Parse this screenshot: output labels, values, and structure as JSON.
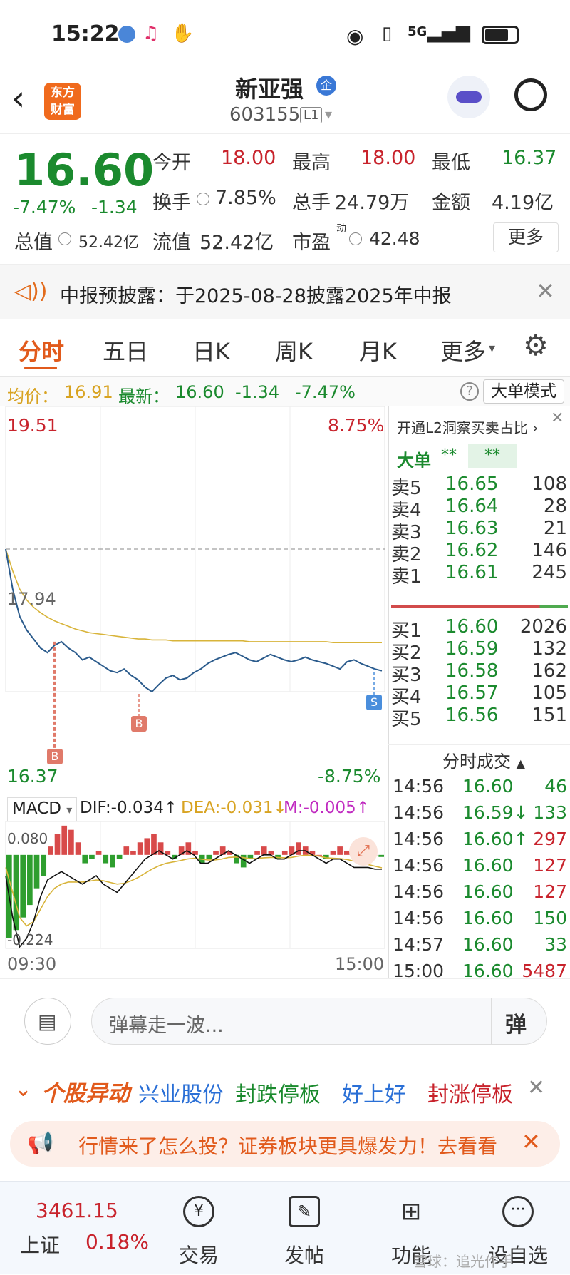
{
  "status_bar": {
    "time": "15:22",
    "network": "5G"
  },
  "header": {
    "app_logo_line1": "东方",
    "app_logo_line2": "财富",
    "stock_name": "新亚强",
    "company_badge": "企",
    "stock_code": "603155",
    "level_badge": "L1"
  },
  "quote": {
    "price": "16.60",
    "change_pct": "-7.47%",
    "change": "-1.34",
    "open_label": "今开",
    "open": "18.00",
    "high_label": "最高",
    "high": "18.00",
    "low_label": "最低",
    "low": "16.37",
    "turnover_label": "换手",
    "turnover": "7.85%",
    "volume_label": "总手",
    "volume": "24.79万",
    "amount_label": "金额",
    "amount": "4.19亿",
    "mktcap_label": "总值",
    "mktcap": "52.42亿",
    "float_label": "流值",
    "float_cap": "52.42亿",
    "pe_label": "市盈",
    "pe_sup": "动",
    "pe": "42.48",
    "more_button": "更多"
  },
  "notice": {
    "text": "中报预披露：于2025-08-28披露2025年中报"
  },
  "tabs": {
    "t1": "分时",
    "t2": "五日",
    "t3": "日K",
    "t4": "周K",
    "t5": "月K",
    "t6": "更多"
  },
  "infobar": {
    "avg_label": "均价：",
    "avg": "16.91",
    "latest_label": "最新：",
    "latest": "16.60",
    "chg": "-1.34",
    "chg_pct": "-7.47%",
    "mode_button": "大单模式"
  },
  "chart": {
    "y_top": "19.51",
    "y_mid": "17.94",
    "y_bottom": "16.37",
    "pct_top": "8.75%",
    "pct_bottom": "-8.75%",
    "marker_b": "B",
    "marker_s": "S",
    "macd_label": "MACD",
    "dif": "DIF:-0.034↑",
    "dea": "DEA:-0.031↓",
    "m": "M:-0.005↑",
    "macd_top": "0.080",
    "macd_bottom": "-0.224",
    "time_start": "09:30",
    "time_end": "15:00",
    "colors": {
      "price_line": "#2b5b8c",
      "avg_line": "#d8b43a",
      "up": "#d84a4a",
      "down": "#2e9e2e"
    }
  },
  "chart_data": {
    "type": "line",
    "ylim": [
      16.37,
      19.51
    ],
    "prev_close": 17.94,
    "price_series": [
      17.94,
      17.5,
      17.2,
      17.05,
      16.95,
      16.85,
      16.8,
      16.88,
      16.92,
      16.85,
      16.8,
      16.72,
      16.75,
      16.7,
      16.65,
      16.6,
      16.58,
      16.62,
      16.55,
      16.5,
      16.42,
      16.37,
      16.45,
      16.52,
      16.55,
      16.5,
      16.52,
      16.58,
      16.62,
      16.68,
      16.72,
      16.75,
      16.78,
      16.8,
      16.76,
      16.72,
      16.7,
      16.74,
      16.78,
      16.75,
      16.72,
      16.7,
      16.72,
      16.75,
      16.72,
      16.7,
      16.68,
      16.65,
      16.62,
      16.7,
      16.72,
      16.68,
      16.65,
      16.62,
      16.6
    ],
    "avg_series": [
      17.94,
      17.7,
      17.5,
      17.38,
      17.3,
      17.24,
      17.19,
      17.15,
      17.12,
      17.09,
      17.06,
      17.04,
      17.02,
      17.01,
      17.0,
      16.99,
      16.98,
      16.97,
      16.96,
      16.95,
      16.95,
      16.94,
      16.94,
      16.94,
      16.93,
      16.93,
      16.93,
      16.93,
      16.93,
      16.93,
      16.93,
      16.93,
      16.93,
      16.93,
      16.93,
      16.92,
      16.92,
      16.92,
      16.92,
      16.92,
      16.92,
      16.92,
      16.92,
      16.92,
      16.92,
      16.92,
      16.92,
      16.91,
      16.91,
      16.91,
      16.91,
      16.91,
      16.91,
      16.91,
      16.91
    ],
    "macd_ylim": [
      -0.224,
      0.08
    ],
    "macd_hist": [
      -0.2,
      -0.18,
      -0.15,
      -0.12,
      -0.08,
      -0.05,
      0.02,
      0.05,
      0.07,
      0.06,
      0.03,
      -0.02,
      -0.01,
      0.01,
      -0.02,
      -0.03,
      -0.01,
      0.02,
      0.01,
      0.03,
      0.04,
      0.05,
      0.03,
      0.01,
      -0.01,
      0.02,
      0.03,
      0.01,
      -0.02,
      -0.01,
      0.01,
      0.02,
      0.01,
      -0.02,
      -0.03,
      -0.01,
      0.01,
      0.02,
      0.01,
      -0.01,
      0.01,
      0.02,
      0.03,
      0.02,
      0.01,
      0.0,
      -0.01,
      0.01,
      0.02,
      0.01,
      -0.01,
      -0.02,
      -0.01,
      0.0,
      -0.005
    ],
    "dif_series": [
      -0.05,
      -0.15,
      -0.22,
      -0.2,
      -0.16,
      -0.1,
      -0.06,
      -0.05,
      -0.04,
      -0.05,
      -0.06,
      -0.07,
      -0.06,
      -0.05,
      -0.07,
      -0.08,
      -0.09,
      -0.07,
      -0.05,
      -0.03,
      -0.01,
      0.0,
      0.01,
      0.0,
      -0.01,
      0.0,
      0.01,
      0.0,
      -0.02,
      -0.02,
      -0.01,
      0.0,
      0.01,
      0.0,
      -0.01,
      -0.02,
      -0.01,
      0.0,
      0.0,
      -0.01,
      -0.01,
      0.0,
      0.01,
      0.01,
      0.0,
      -0.01,
      -0.02,
      -0.01,
      -0.01,
      -0.02,
      -0.03,
      -0.03,
      -0.03,
      -0.034,
      -0.034
    ],
    "dea_series": [
      -0.03,
      -0.09,
      -0.15,
      -0.17,
      -0.16,
      -0.13,
      -0.1,
      -0.08,
      -0.07,
      -0.065,
      -0.065,
      -0.065,
      -0.063,
      -0.06,
      -0.062,
      -0.066,
      -0.07,
      -0.068,
      -0.062,
      -0.054,
      -0.044,
      -0.034,
      -0.026,
      -0.02,
      -0.017,
      -0.014,
      -0.01,
      -0.008,
      -0.01,
      -0.012,
      -0.012,
      -0.01,
      -0.006,
      -0.005,
      -0.006,
      -0.009,
      -0.009,
      -0.007,
      -0.006,
      -0.006,
      -0.007,
      -0.006,
      -0.003,
      -0.001,
      -0.001,
      -0.003,
      -0.007,
      -0.008,
      -0.009,
      -0.011,
      -0.015,
      -0.019,
      -0.023,
      -0.027,
      -0.031
    ]
  },
  "orderbook": {
    "l2_link": "开通L2洞察买卖占比",
    "big_label": "大单",
    "big_v1": "**",
    "big_v2": "**",
    "asks": [
      {
        "label": "卖5",
        "price": "16.65",
        "vol": "108"
      },
      {
        "label": "卖4",
        "price": "16.64",
        "vol": "28"
      },
      {
        "label": "卖3",
        "price": "16.63",
        "vol": "21"
      },
      {
        "label": "卖2",
        "price": "16.62",
        "vol": "146"
      },
      {
        "label": "卖1",
        "price": "16.61",
        "vol": "245"
      }
    ],
    "bids": [
      {
        "label": "买1",
        "price": "16.60",
        "vol": "2026"
      },
      {
        "label": "买2",
        "price": "16.59",
        "vol": "132"
      },
      {
        "label": "买3",
        "price": "16.58",
        "vol": "162"
      },
      {
        "label": "买4",
        "price": "16.57",
        "vol": "105"
      },
      {
        "label": "买5",
        "price": "16.56",
        "vol": "151"
      }
    ],
    "trades_title": "分时成交",
    "trades": [
      {
        "time": "14:56",
        "price": "16.60",
        "vol": "46",
        "dir": ""
      },
      {
        "time": "14:56",
        "price": "16.59↓",
        "vol": "133",
        "dir": "down"
      },
      {
        "time": "14:56",
        "price": "16.60↑",
        "vol": "297",
        "dir": "up"
      },
      {
        "time": "14:56",
        "price": "16.60",
        "vol": "127",
        "dir": "up"
      },
      {
        "time": "14:56",
        "price": "16.60",
        "vol": "127",
        "dir": "up"
      },
      {
        "time": "14:56",
        "price": "16.60",
        "vol": "150",
        "dir": "down"
      },
      {
        "time": "14:57",
        "price": "16.60",
        "vol": "33",
        "dir": "down"
      },
      {
        "time": "15:00",
        "price": "16.60",
        "vol": "5487",
        "dir": "up"
      }
    ]
  },
  "danmu": {
    "placeholder": "弹幕走一波...",
    "toggle": "弹"
  },
  "alerts": {
    "title": "个股异动",
    "item1_name": "兴业股份",
    "item1_tag": "封跌停板",
    "item2_name": "好上好",
    "item2_tag": "封涨停板"
  },
  "promo": {
    "text": "行情来了怎么投？证券板块更具爆发力！去看看"
  },
  "bottom_nav": {
    "index_value": "3461.15",
    "index_name": "上证",
    "index_change": "0.18%",
    "trade": "交易",
    "post": "发帖",
    "functions": "功能",
    "watchlist": "设自选",
    "watermark": "雪球：追光作手"
  }
}
